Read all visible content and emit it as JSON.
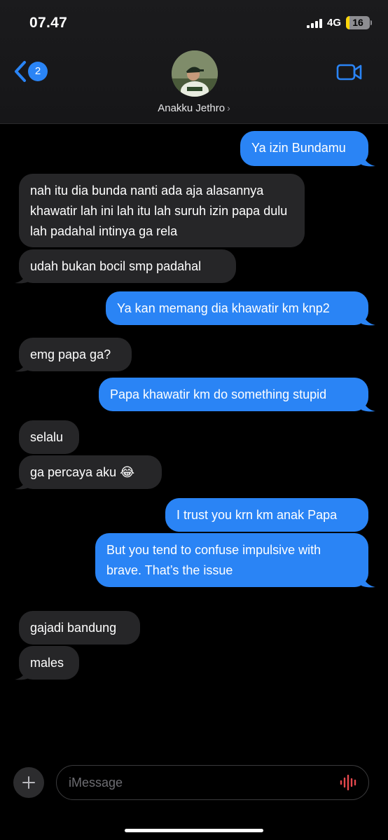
{
  "status_bar": {
    "time": "07.47",
    "network": "4G",
    "battery": "16",
    "battery_level": 0.16
  },
  "header": {
    "back_badge": "2",
    "contact_name": "Anakku Jethro",
    "name_chevron": "›",
    "icons": {
      "back": "chevron-left-icon",
      "video": "video-camera-icon"
    },
    "accent_color": "#2a84f5"
  },
  "messages": [
    {
      "side": "sent",
      "text": "Ya izin Bundamu"
    },
    {
      "side": "received",
      "text": "nah itu dia bunda nanti ada aja alasannya khawatir lah ini lah itu lah suruh izin papa dulu lah padahal intinya ga rela"
    },
    {
      "side": "received",
      "text": "udah bukan bocil smp padahal"
    },
    {
      "side": "sent",
      "text": "Ya kan memang dia khawatir km knp2"
    },
    {
      "side": "received",
      "text": "emg papa ga?"
    },
    {
      "side": "sent",
      "text": "Papa khawatir km do something stupid"
    },
    {
      "side": "received",
      "text": "selalu"
    },
    {
      "side": "received",
      "text": "ga percaya aku 😂"
    },
    {
      "side": "sent",
      "text": "I trust you krn km anak Papa"
    },
    {
      "side": "sent",
      "text": "But you tend to confuse impulsive with brave. That’s the issue"
    },
    {
      "side": "received",
      "text": "gajadi bandung"
    },
    {
      "side": "received",
      "text": "males"
    }
  ],
  "composer": {
    "placeholder": "iMessage",
    "value": "",
    "icons": {
      "add": "plus-icon",
      "audio": "waveform-icon"
    }
  },
  "colors": {
    "sent_bubble": "#2a84f5",
    "received_bubble": "#262628",
    "background": "#000000"
  }
}
